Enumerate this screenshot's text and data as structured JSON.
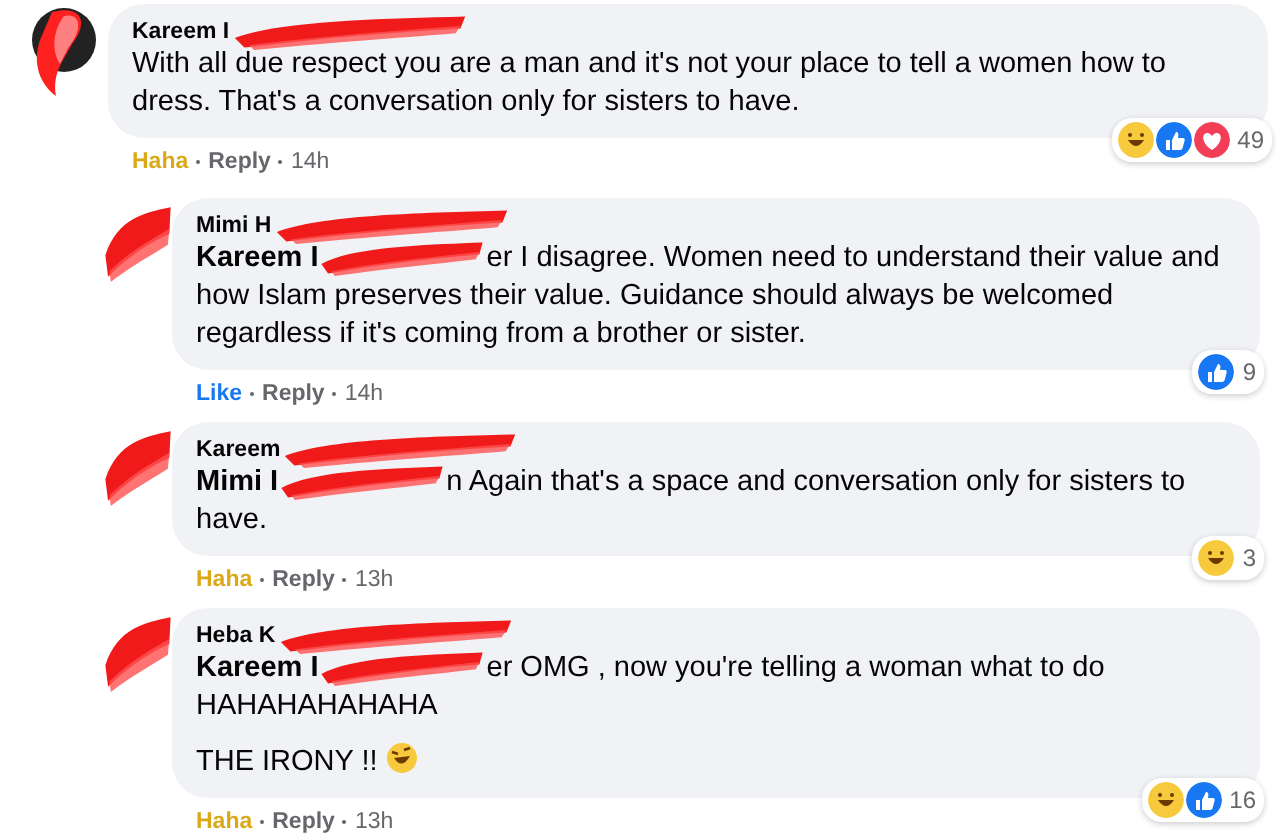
{
  "comments": [
    {
      "author": "Kareem I",
      "paragraphs": [
        {
          "text": "With all due respect you are a man and it's not your place to tell a women how to dress. That's a conversation only for sisters to have."
        }
      ],
      "reaction": {
        "label": "Haha",
        "kind": "haha"
      },
      "reply": "Reply",
      "time": "14h",
      "reactions": [
        {
          "kind": "haha"
        },
        {
          "kind": "like"
        },
        {
          "kind": "love"
        }
      ],
      "count": "49",
      "children": [
        {
          "author": "Mimi H",
          "mention": "Kareem I",
          "paragraphs": [
            {
              "text": "er I disagree. Women need to understand their value and how Islam preserves their value. Guidance should always be welcomed regardless if it's coming from a brother or sister."
            }
          ],
          "reaction": {
            "label": "Like",
            "kind": "like"
          },
          "reply": "Reply",
          "time": "14h",
          "reactions": [
            {
              "kind": "like"
            }
          ],
          "count": "9"
        },
        {
          "author": "Kareem",
          "mention": "Mimi I",
          "paragraphs": [
            {
              "text": "n Again that's a space and conversation only for sisters to have."
            }
          ],
          "reaction": {
            "label": "Haha",
            "kind": "haha"
          },
          "reply": "Reply",
          "time": "13h",
          "reactions": [
            {
              "kind": "haha"
            }
          ],
          "count": "3"
        },
        {
          "author": "Heba K",
          "mention": "Kareem I",
          "paragraphs": [
            {
              "text": "er OMG , now you're telling a woman what to do HAHAHAHAHAHA"
            },
            {
              "text": "THE IRONY !!",
              "trailing_emoji": true
            }
          ],
          "reaction": {
            "label": "Haha",
            "kind": "haha"
          },
          "reply": "Reply",
          "time": "13h",
          "reactions": [
            {
              "kind": "haha"
            },
            {
              "kind": "like"
            }
          ],
          "count": "16"
        }
      ]
    }
  ]
}
